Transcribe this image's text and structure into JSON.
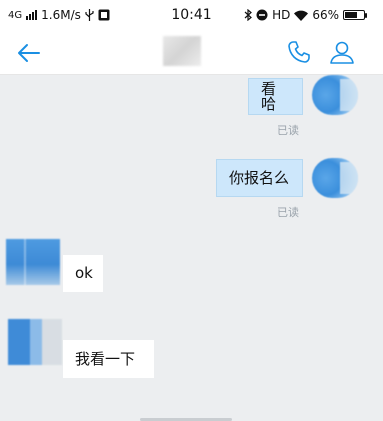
{
  "status_bar": {
    "network": "4G",
    "speed": "1.6M/s",
    "time": "10:41",
    "hd": "HD",
    "battery": "66%",
    "battery_level": 0.66
  },
  "header": {
    "back_icon": "arrow-left-icon",
    "phone_icon": "phone-icon",
    "profile_icon": "person-icon",
    "accent_color": "#1a8fe3"
  },
  "messages": [
    {
      "direction": "outgoing",
      "text": "看哈",
      "status": "已读"
    },
    {
      "direction": "outgoing",
      "text": "你报名么",
      "status": "已读"
    },
    {
      "direction": "incoming",
      "text": "ok"
    },
    {
      "direction": "incoming",
      "text": "我看一下"
    }
  ],
  "colors": {
    "chat_background": "#eceef0",
    "outgoing_bubble": "#cde7fb",
    "incoming_bubble": "#ffffff"
  }
}
